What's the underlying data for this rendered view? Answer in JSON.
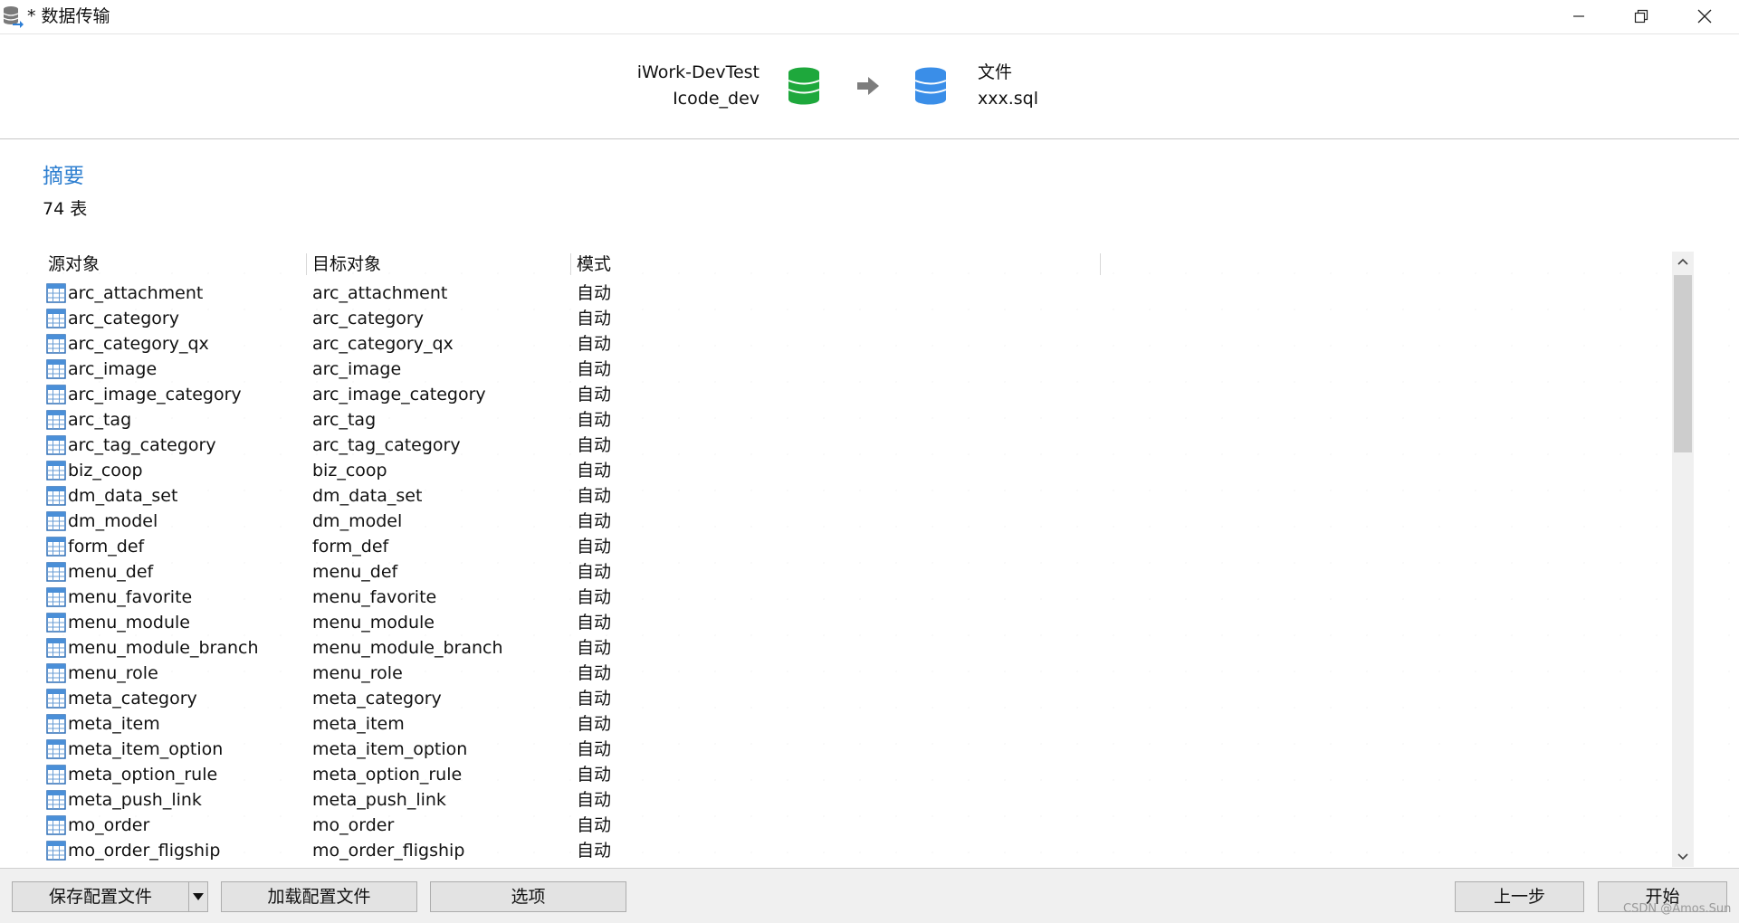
{
  "window": {
    "title": "* 数据传输"
  },
  "transfer": {
    "source_connection": "iWork-DevTest",
    "source_database": "Icode_dev",
    "target_type": "文件",
    "target_file": "xxx.sql",
    "source_icon": "database-icon",
    "target_icon": "database-icon",
    "source_color": "#1ea83c",
    "target_color": "#3a8ee8"
  },
  "summary": {
    "title": "摘要",
    "count": "74 表"
  },
  "table": {
    "headers": {
      "source": "源对象",
      "target": "目标对象",
      "mode": "模式"
    },
    "rows": [
      {
        "source": "arc_attachment",
        "target": "arc_attachment",
        "mode": "自动"
      },
      {
        "source": "arc_category",
        "target": "arc_category",
        "mode": "自动"
      },
      {
        "source": "arc_category_qx",
        "target": "arc_category_qx",
        "mode": "自动"
      },
      {
        "source": "arc_image",
        "target": "arc_image",
        "mode": "自动"
      },
      {
        "source": "arc_image_category",
        "target": "arc_image_category",
        "mode": "自动"
      },
      {
        "source": "arc_tag",
        "target": "arc_tag",
        "mode": "自动"
      },
      {
        "source": "arc_tag_category",
        "target": "arc_tag_category",
        "mode": "自动"
      },
      {
        "source": "biz_coop",
        "target": "biz_coop",
        "mode": "自动"
      },
      {
        "source": "dm_data_set",
        "target": "dm_data_set",
        "mode": "自动"
      },
      {
        "source": "dm_model",
        "target": "dm_model",
        "mode": "自动"
      },
      {
        "source": "form_def",
        "target": "form_def",
        "mode": "自动"
      },
      {
        "source": "menu_def",
        "target": "menu_def",
        "mode": "自动"
      },
      {
        "source": "menu_favorite",
        "target": "menu_favorite",
        "mode": "自动"
      },
      {
        "source": "menu_module",
        "target": "menu_module",
        "mode": "自动"
      },
      {
        "source": "menu_module_branch",
        "target": "menu_module_branch",
        "mode": "自动"
      },
      {
        "source": "menu_role",
        "target": "menu_role",
        "mode": "自动"
      },
      {
        "source": "meta_category",
        "target": "meta_category",
        "mode": "自动"
      },
      {
        "source": "meta_item",
        "target": "meta_item",
        "mode": "自动"
      },
      {
        "source": "meta_item_option",
        "target": "meta_item_option",
        "mode": "自动"
      },
      {
        "source": "meta_option_rule",
        "target": "meta_option_rule",
        "mode": "自动"
      },
      {
        "source": "meta_push_link",
        "target": "meta_push_link",
        "mode": "自动"
      },
      {
        "source": "mo_order",
        "target": "mo_order",
        "mode": "自动"
      },
      {
        "source": "mo_order_fligship",
        "target": "mo_order_fligship",
        "mode": "自动"
      }
    ]
  },
  "footer": {
    "save_config": "保存配置文件",
    "load_config": "加载配置文件",
    "options": "选项",
    "previous": "上一步",
    "start": "开始"
  },
  "watermark": "CSDN @Amos.Sun"
}
